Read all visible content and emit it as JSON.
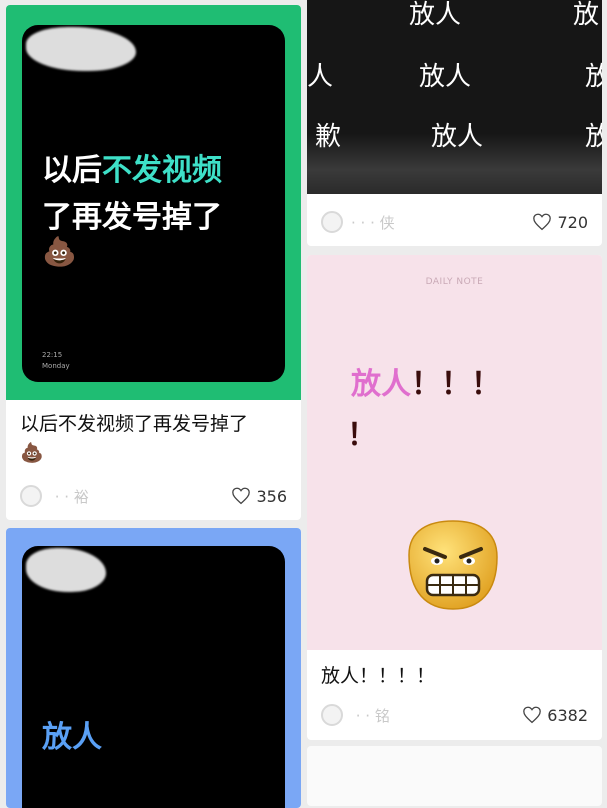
{
  "feed": {
    "card1": {
      "bg_color": "#1fbd73",
      "cover_line1_a": "以后",
      "cover_line1_b": "不发视频",
      "cover_line2": "了再发号掉了",
      "cover_emoji": "💩",
      "clock_time": "22:15",
      "clock_day": "Monday",
      "title": "以后不发视频了再发号掉了",
      "title_emoji": "💩",
      "author": " · · 裕",
      "likes": "356"
    },
    "card2": {
      "texts": [
        "放人",
        "放",
        "人",
        "放人",
        "放",
        "歉",
        "放人",
        "放"
      ],
      "author": "· · · 侠",
      "likes": "720"
    },
    "card3": {
      "bg_color": "#f7e2ea",
      "header": "DAILY NOTE",
      "cover_text": "放人",
      "cover_marks": "！！！",
      "cover_mark2": "！",
      "title": "放人！！！！",
      "author": " · · 铭",
      "likes": "6382"
    },
    "card4": {
      "bg_color": "#7aa7f5",
      "cover_text": "放人"
    }
  }
}
